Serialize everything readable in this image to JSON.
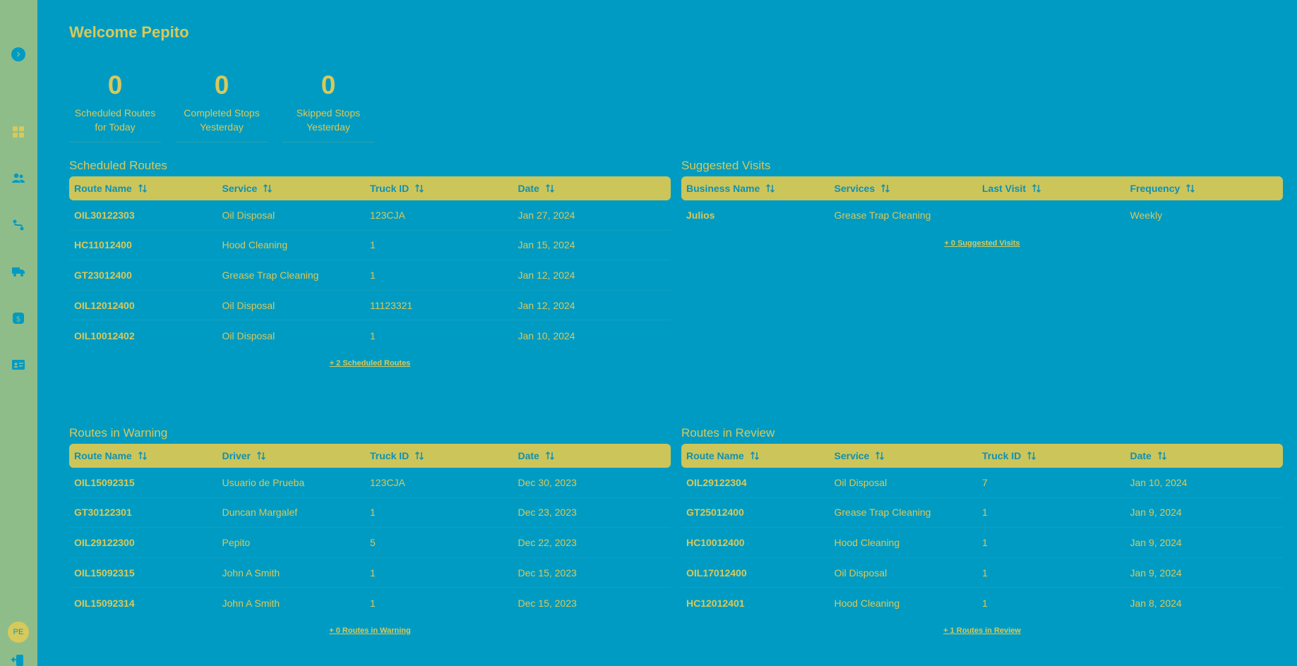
{
  "welcome": "Welcome Pepito",
  "stats": [
    {
      "value": "0",
      "label_1": "Scheduled Routes",
      "label_2": "for Today"
    },
    {
      "value": "0",
      "label_1": "Completed Stops",
      "label_2": "Yesterday"
    },
    {
      "value": "0",
      "label_1": "Skipped Stops",
      "label_2": "Yesterday"
    }
  ],
  "user": {
    "initials": "PE"
  },
  "scheduled": {
    "title": "Scheduled Routes",
    "headers": [
      "Route Name",
      "Service",
      "Truck ID",
      "Date"
    ],
    "rows": [
      [
        "OIL30122303",
        "Oil Disposal",
        "123CJA",
        "Jan 27, 2024"
      ],
      [
        "HC11012400",
        "Hood Cleaning",
        "1",
        "Jan 15, 2024"
      ],
      [
        "GT23012400",
        "Grease Trap Cleaning",
        "1",
        "Jan 12, 2024"
      ],
      [
        "OIL12012400",
        "Oil Disposal",
        "11123321",
        "Jan 12, 2024"
      ],
      [
        "OIL10012402",
        "Oil Disposal",
        "1",
        "Jan 10, 2024"
      ]
    ],
    "more": "+ 2 Scheduled Routes"
  },
  "suggested": {
    "title": "Suggested Visits",
    "headers": [
      "Business Name",
      "Services",
      "Last Visit",
      "Frequency"
    ],
    "rows": [
      [
        "Julios",
        "Grease Trap Cleaning",
        "",
        "Weekly"
      ]
    ],
    "more": "+ 0 Suggested Visits"
  },
  "warning": {
    "title": "Routes in Warning",
    "headers": [
      "Route Name",
      "Driver",
      "Truck ID",
      "Date"
    ],
    "rows": [
      [
        "OIL15092315",
        "Usuario de Prueba",
        "123CJA",
        "Dec 30, 2023"
      ],
      [
        "GT30122301",
        "Duncan Margalef",
        "1",
        "Dec 23, 2023"
      ],
      [
        "OIL29122300",
        "Pepito",
        "5",
        "Dec 22, 2023"
      ],
      [
        "OIL15092315",
        "John A Smith",
        "1",
        "Dec 15, 2023"
      ],
      [
        "OIL15092314",
        "John A Smith",
        "1",
        "Dec 15, 2023"
      ]
    ],
    "more": "+ 0 Routes in Warning"
  },
  "review": {
    "title": "Routes in Review",
    "headers": [
      "Route Name",
      "Service",
      "Truck ID",
      "Date"
    ],
    "rows": [
      [
        "OIL29122304",
        "Oil Disposal",
        "7",
        "Jan 10, 2024"
      ],
      [
        "GT25012400",
        "Grease Trap Cleaning",
        "1",
        "Jan 9, 2024"
      ],
      [
        "HC10012400",
        "Hood Cleaning",
        "1",
        "Jan 9, 2024"
      ],
      [
        "OIL17012400",
        "Oil Disposal",
        "1",
        "Jan 9, 2024"
      ],
      [
        "HC12012401",
        "Hood Cleaning",
        "1",
        "Jan 8, 2024"
      ]
    ],
    "more": "+ 1 Routes in Review"
  }
}
